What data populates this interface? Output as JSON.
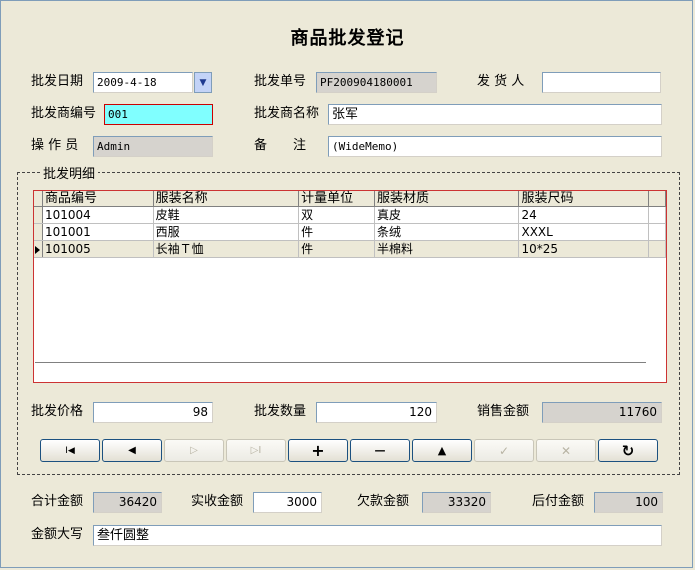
{
  "title": "商品批发登记",
  "header": {
    "date_label": "批发日期",
    "date_value": "2009-4-18",
    "order_no_label": "批发单号",
    "order_no_value": "PF200904180001",
    "shipper_label": "发 货 人",
    "shipper_value": "",
    "wholesaler_id_label": "批发商编号",
    "wholesaler_id_value": "001",
    "wholesaler_name_label": "批发商名称",
    "wholesaler_name_value": "张军",
    "operator_label": "操 作 员",
    "operator_value": "Admin",
    "remark_label": "备　　注",
    "remark_value": "(WideMemo)"
  },
  "detail": {
    "legend": "批发明细",
    "columns": [
      "商品编号",
      "服装名称",
      "计量单位",
      "服装材质",
      "服装尺码"
    ],
    "rows": [
      [
        "101004",
        "皮鞋",
        "双",
        "真皮",
        "24"
      ],
      [
        "101001",
        "西服",
        "件",
        "条绒",
        "XXXL"
      ],
      [
        "101005",
        "长袖Ｔ恤",
        "件",
        "半棉料",
        "10*25"
      ]
    ],
    "selected_row": 2,
    "price_label": "批发价格",
    "price_value": "98",
    "qty_label": "批发数量",
    "qty_value": "120",
    "sales_label": "销售金额",
    "sales_value": "11760"
  },
  "navigator": [
    {
      "name": "first",
      "glyph": "I◀",
      "enabled": true
    },
    {
      "name": "prior",
      "glyph": "◀",
      "enabled": true
    },
    {
      "name": "next",
      "glyph": "▷",
      "enabled": false
    },
    {
      "name": "last",
      "glyph": "▷I",
      "enabled": false
    },
    {
      "name": "insert",
      "glyph": "+",
      "enabled": true
    },
    {
      "name": "delete",
      "glyph": "—",
      "enabled": true
    },
    {
      "name": "edit",
      "glyph": "▲",
      "enabled": true
    },
    {
      "name": "post",
      "glyph": "✓",
      "enabled": false
    },
    {
      "name": "cancel",
      "glyph": "✕",
      "enabled": false
    },
    {
      "name": "refresh",
      "glyph": "↻",
      "enabled": true
    }
  ],
  "footer": {
    "total_label": "合计金额",
    "total_value": "36420",
    "paid_label": "实收金额",
    "paid_value": "3000",
    "owed_label": "欠款金额",
    "owed_value": "33320",
    "later_label": "后付金额",
    "later_value": "100",
    "amount_words_label": "金额大写",
    "amount_words_value": "叁仟圆整"
  }
}
